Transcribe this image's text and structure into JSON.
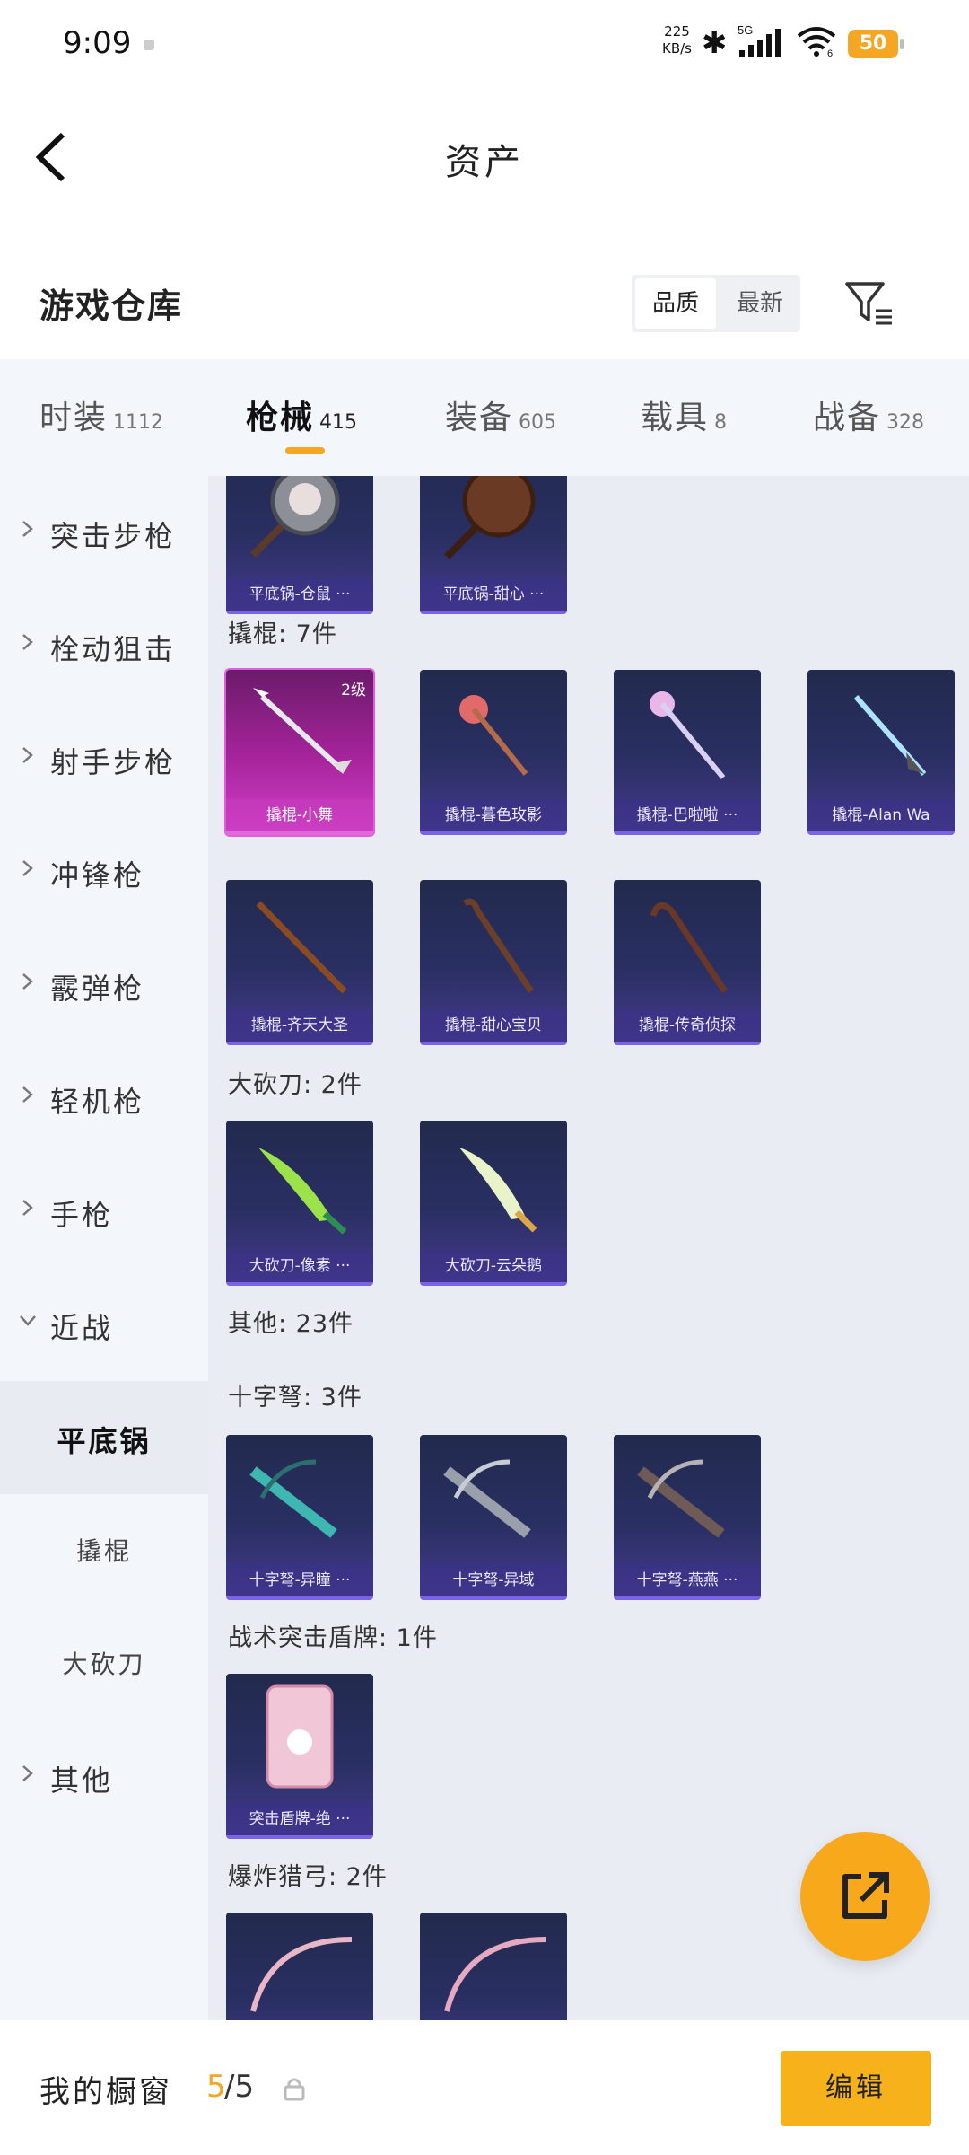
{
  "status_bar": {
    "time": "9:09",
    "net_speed_value": "225",
    "net_speed_unit": "KB/s",
    "network_type": "5G",
    "wifi_level": "6",
    "battery": "50"
  },
  "nav": {
    "title": "资产"
  },
  "header": {
    "title": "游戏仓库",
    "sort_options": [
      "品质",
      "最新"
    ],
    "sort_active": "品质"
  },
  "tabs": [
    {
      "label": "时装",
      "count": "1112"
    },
    {
      "label": "枪械",
      "count": "415"
    },
    {
      "label": "装备",
      "count": "605"
    },
    {
      "label": "载具",
      "count": "8"
    },
    {
      "label": "战备",
      "count": "328"
    }
  ],
  "active_tab": "枪械",
  "sidebar": [
    {
      "label": "突击步枪"
    },
    {
      "label": "栓动狙击"
    },
    {
      "label": "射手步枪"
    },
    {
      "label": "冲锋枪"
    },
    {
      "label": "霰弹枪"
    },
    {
      "label": "轻机枪"
    },
    {
      "label": "手枪"
    },
    {
      "label": "近战"
    },
    {
      "label": "平底锅"
    },
    {
      "label": "撬棍"
    },
    {
      "label": "大砍刀"
    },
    {
      "label": "其他"
    }
  ],
  "sections": {
    "pan_items": [
      "平底锅-仓鼠 ···",
      "平底锅-甜心 ···"
    ],
    "crowbar_header": "撬棍: 7件",
    "crowbar_items": [
      "撬棍-小舞",
      "撬棍-暮色玫影",
      "撬棍-巴啦啦 ···",
      "撬棍-Alan Wa",
      "撬棍-齐天大圣",
      "撬棍-甜心宝贝",
      "撬棍-传奇侦探"
    ],
    "crowbar_level": "2级",
    "machete_header": "大砍刀: 2件",
    "machete_items": [
      "大砍刀-像素 ···",
      "大砍刀-云朵鹅"
    ],
    "other_header": "其他: 23件",
    "crossbow_header": "十字弩: 3件",
    "crossbow_items": [
      "十字弩-异瞳 ···",
      "十字弩-异域",
      "十字弩-燕燕 ···"
    ],
    "shield_header": "战术突击盾牌: 1件",
    "shield_items": [
      "突击盾牌-绝 ···"
    ],
    "bow_header": "爆炸猎弓: 2件"
  },
  "bottom": {
    "label": "我的橱窗",
    "current": "5",
    "total": "/5",
    "edit_label": "编辑"
  },
  "colors": {
    "accent": "#f5a623",
    "card_bg": "#2a2f63",
    "card_rare": "#d040c9"
  }
}
